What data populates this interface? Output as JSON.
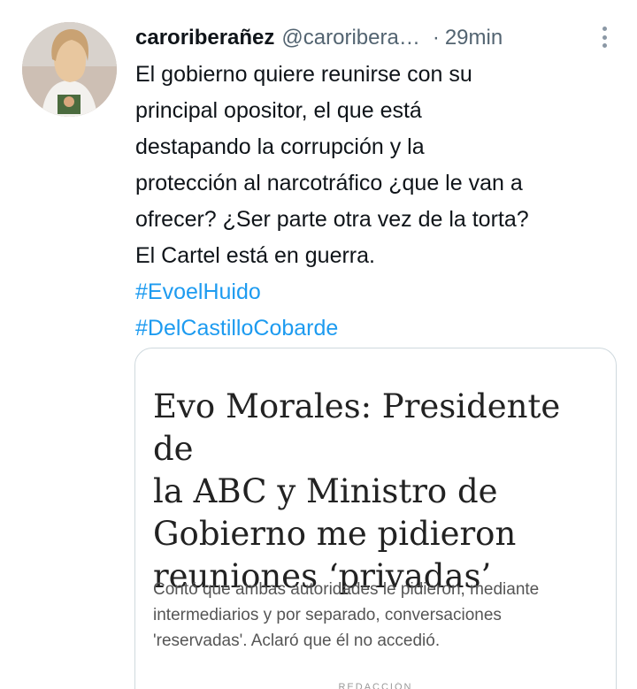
{
  "tweet": {
    "display_name": "caroriberañez",
    "handle": "@caroribera…",
    "separator": "·",
    "time": "29min",
    "text_lines": [
      "El gobierno quiere reunirse con su",
      "principal opositor, el que está",
      "destapando la corrupción y la",
      "protección al narcotráfico ¿que le van a",
      "ofrecer? ¿Ser parte otra vez de la torta?",
      "El Cartel está en guerra."
    ],
    "hashtags": [
      "#EvoelHuido",
      "#DelCastilloCobarde"
    ]
  },
  "card": {
    "title_lines": [
      "Evo Morales: Presidente de",
      "la ABC y Ministro de",
      "Gobierno me pidieron",
      "reuniones ‘privadas’"
    ],
    "description_lines": [
      "Contó que ambas autoridades le pidieron, mediante",
      "intermediarios y por separado, conversaciones",
      "'reservadas'. Aclaró que él no accedió."
    ],
    "footer": "REDACCIÓN"
  },
  "colors": {
    "link": "#1d9bf0",
    "secondary_text": "#536471",
    "border": "#cfd9de"
  },
  "icons": [
    "more-options-icon"
  ]
}
